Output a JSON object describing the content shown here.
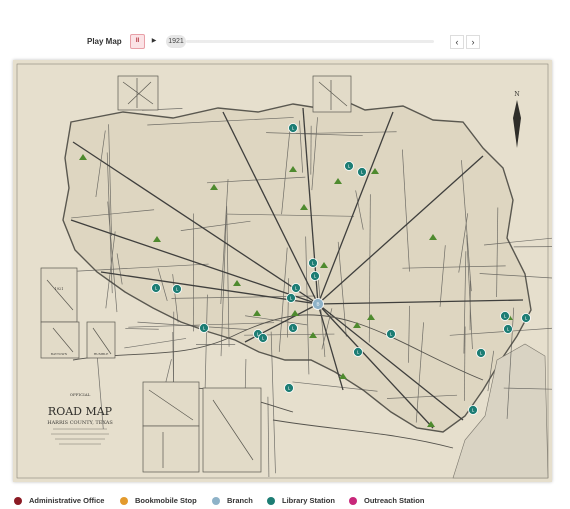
{
  "controls": {
    "play_label": "Play Map",
    "pause_glyph": "II",
    "play_glyph": "▶",
    "year": "1921",
    "prev_glyph": "‹",
    "next_glyph": "›"
  },
  "map": {
    "title_small": "OFFICIAL",
    "title_main": "ROAD MAP",
    "title_sub": "HARRIS COUNTY, TEXAS",
    "north_letter": "N",
    "inset_date": "1921",
    "inset_label_1": "BAYTOWN",
    "inset_label_2": "HUMBLE",
    "markers": [
      {
        "type": "Library Station",
        "glyph": "L"
      },
      {
        "type": "Library Station",
        "glyph": "L"
      },
      {
        "type": "Library Station",
        "glyph": "L"
      },
      {
        "type": "Library Station",
        "glyph": "L"
      },
      {
        "type": "Library Station",
        "glyph": "L"
      },
      {
        "type": "Library Station",
        "glyph": "L"
      },
      {
        "type": "Library Station",
        "glyph": "L"
      },
      {
        "type": "Library Station",
        "glyph": "L"
      },
      {
        "type": "Library Station",
        "glyph": "L"
      },
      {
        "type": "Library Station",
        "glyph": "L"
      },
      {
        "type": "Library Station",
        "glyph": "L"
      },
      {
        "type": "Library Station",
        "glyph": "L"
      },
      {
        "type": "Library Station",
        "glyph": "L"
      },
      {
        "type": "Library Station",
        "glyph": "L"
      },
      {
        "type": "Library Station",
        "glyph": "L"
      },
      {
        "type": "Library Station",
        "glyph": "L"
      },
      {
        "type": "Library Station",
        "glyph": "L"
      },
      {
        "type": "Library Station",
        "glyph": "L"
      },
      {
        "type": "Library Station",
        "glyph": "L"
      },
      {
        "type": "Library Station",
        "glyph": "L"
      },
      {
        "type": "Library Station",
        "glyph": "L"
      },
      {
        "type": "Branch",
        "glyph": "B"
      }
    ]
  },
  "legend": [
    {
      "label": "Administrative Office",
      "color": "#8b1a24",
      "icon": "administrative-office-icon"
    },
    {
      "label": "Bookmobile Stop",
      "color": "#e39a2d",
      "icon": "bookmobile-stop-icon"
    },
    {
      "label": "Branch",
      "color": "#8eb2c8",
      "icon": "branch-icon"
    },
    {
      "label": "Library Station",
      "color": "#1d7d74",
      "icon": "library-station-icon"
    },
    {
      "label": "Outreach Station",
      "color": "#c8277a",
      "icon": "outreach-station-icon"
    }
  ],
  "colors": {
    "library_station": "#1d7d74",
    "branch": "#8eb2c8",
    "tree_marker": "#4e8a2e",
    "map_paper": "#e6dfcd",
    "road_ink": "#4a4a48"
  }
}
